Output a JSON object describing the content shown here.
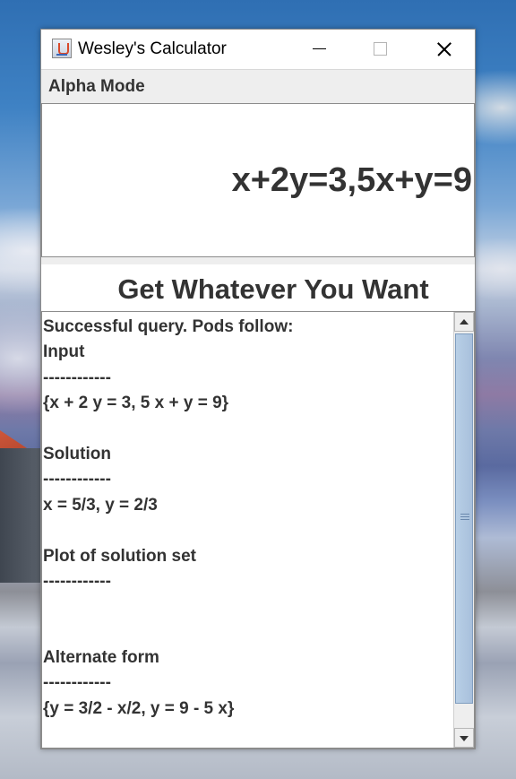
{
  "window": {
    "title": "Wesley's Calculator",
    "icon": "java-cup-icon"
  },
  "mode": {
    "label": "Alpha Mode"
  },
  "input": {
    "value": "x+2y=3,5x+y=9"
  },
  "submit": {
    "label": "Get Whatever You Want"
  },
  "results": {
    "lines": [
      "Successful query. Pods follow:",
      "Input",
      "------------",
      "{x + 2 y = 3, 5 x + y = 9}",
      "",
      "Solution",
      "------------",
      "x = 5/3, y = 2/3",
      "",
      "Plot of solution set",
      "------------",
      "",
      "",
      "Alternate form",
      "------------",
      "{y = 3/2 - x/2, y = 9 - 5 x}"
    ]
  },
  "colors": {
    "text": "#333333",
    "panel_bg": "#eeeeee",
    "scroll_thumb": "#b8cfe6"
  }
}
